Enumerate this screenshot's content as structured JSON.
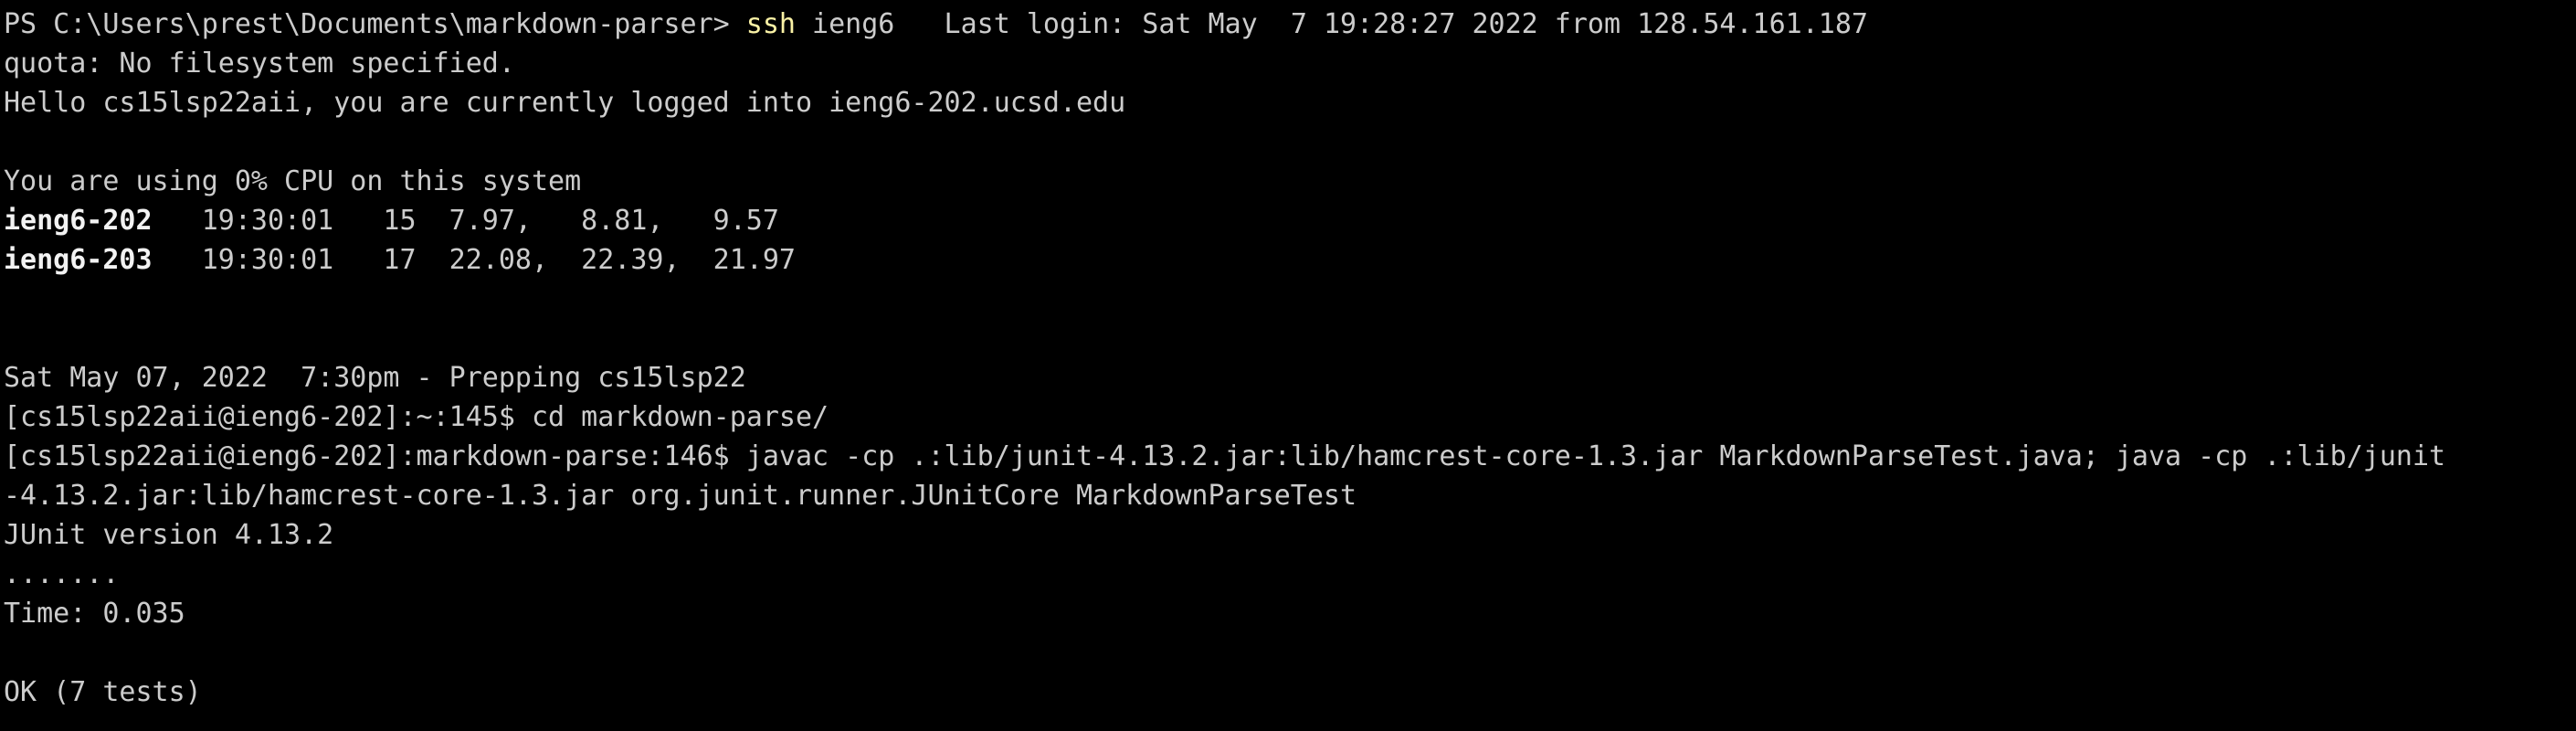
{
  "theme": {
    "background": "#000000",
    "foreground": "#cccccc",
    "command_color": "#f9f1a5",
    "bold_color": "#f2f2f2"
  },
  "terminal": {
    "line1": {
      "prompt": "PS C:\\Users\\prest\\Documents\\markdown-parser> ",
      "command": "ssh",
      "rest": " ieng6   Last login: Sat May  7 19:28:27 2022 from 128.54.161.187"
    },
    "line2": "quota: No filesystem specified.",
    "line3": "Hello cs15lsp22aii, you are currently logged into ieng6-202.ucsd.edu",
    "line5": "You are using 0% CPU on this system",
    "load_rows": [
      {
        "host": "ieng6-202",
        "stats": "   19:30:01   15  7.97,   8.81,   9.57"
      },
      {
        "host": "ieng6-203",
        "stats": "   19:30:01   17  22.08,  22.39,  21.97"
      }
    ],
    "line10": "Sat May 07, 2022  7:30pm - Prepping cs15lsp22",
    "line11": "[cs15lsp22aii@ieng6-202]:~:145$ cd markdown-parse/",
    "line12": "[cs15lsp22aii@ieng6-202]:markdown-parse:146$ javac -cp .:lib/junit-4.13.2.jar:lib/hamcrest-core-1.3.jar MarkdownParseTest.java; java -cp .:lib/junit",
    "line13": "-4.13.2.jar:lib/hamcrest-core-1.3.jar org.junit.runner.JUnitCore MarkdownParseTest",
    "line14": "JUnit version 4.13.2",
    "line15": ".......",
    "line16": "Time: 0.035",
    "line18": "OK (7 tests)"
  }
}
